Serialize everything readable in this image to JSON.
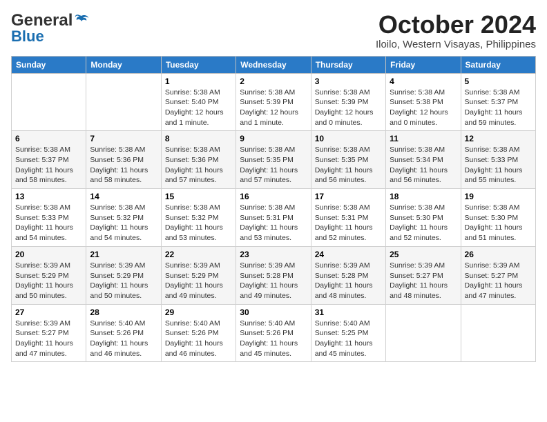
{
  "header": {
    "logo_line1": "General",
    "logo_line2": "Blue",
    "month": "October 2024",
    "location": "Iloilo, Western Visayas, Philippines"
  },
  "weekdays": [
    "Sunday",
    "Monday",
    "Tuesday",
    "Wednesday",
    "Thursday",
    "Friday",
    "Saturday"
  ],
  "weeks": [
    [
      {
        "day": "",
        "sunrise": "",
        "sunset": "",
        "daylight": ""
      },
      {
        "day": "",
        "sunrise": "",
        "sunset": "",
        "daylight": ""
      },
      {
        "day": "1",
        "sunrise": "Sunrise: 5:38 AM",
        "sunset": "Sunset: 5:40 PM",
        "daylight": "Daylight: 12 hours and 1 minute."
      },
      {
        "day": "2",
        "sunrise": "Sunrise: 5:38 AM",
        "sunset": "Sunset: 5:39 PM",
        "daylight": "Daylight: 12 hours and 1 minute."
      },
      {
        "day": "3",
        "sunrise": "Sunrise: 5:38 AM",
        "sunset": "Sunset: 5:39 PM",
        "daylight": "Daylight: 12 hours and 0 minutes."
      },
      {
        "day": "4",
        "sunrise": "Sunrise: 5:38 AM",
        "sunset": "Sunset: 5:38 PM",
        "daylight": "Daylight: 12 hours and 0 minutes."
      },
      {
        "day": "5",
        "sunrise": "Sunrise: 5:38 AM",
        "sunset": "Sunset: 5:37 PM",
        "daylight": "Daylight: 11 hours and 59 minutes."
      }
    ],
    [
      {
        "day": "6",
        "sunrise": "Sunrise: 5:38 AM",
        "sunset": "Sunset: 5:37 PM",
        "daylight": "Daylight: 11 hours and 58 minutes."
      },
      {
        "day": "7",
        "sunrise": "Sunrise: 5:38 AM",
        "sunset": "Sunset: 5:36 PM",
        "daylight": "Daylight: 11 hours and 58 minutes."
      },
      {
        "day": "8",
        "sunrise": "Sunrise: 5:38 AM",
        "sunset": "Sunset: 5:36 PM",
        "daylight": "Daylight: 11 hours and 57 minutes."
      },
      {
        "day": "9",
        "sunrise": "Sunrise: 5:38 AM",
        "sunset": "Sunset: 5:35 PM",
        "daylight": "Daylight: 11 hours and 57 minutes."
      },
      {
        "day": "10",
        "sunrise": "Sunrise: 5:38 AM",
        "sunset": "Sunset: 5:35 PM",
        "daylight": "Daylight: 11 hours and 56 minutes."
      },
      {
        "day": "11",
        "sunrise": "Sunrise: 5:38 AM",
        "sunset": "Sunset: 5:34 PM",
        "daylight": "Daylight: 11 hours and 56 minutes."
      },
      {
        "day": "12",
        "sunrise": "Sunrise: 5:38 AM",
        "sunset": "Sunset: 5:33 PM",
        "daylight": "Daylight: 11 hours and 55 minutes."
      }
    ],
    [
      {
        "day": "13",
        "sunrise": "Sunrise: 5:38 AM",
        "sunset": "Sunset: 5:33 PM",
        "daylight": "Daylight: 11 hours and 54 minutes."
      },
      {
        "day": "14",
        "sunrise": "Sunrise: 5:38 AM",
        "sunset": "Sunset: 5:32 PM",
        "daylight": "Daylight: 11 hours and 54 minutes."
      },
      {
        "day": "15",
        "sunrise": "Sunrise: 5:38 AM",
        "sunset": "Sunset: 5:32 PM",
        "daylight": "Daylight: 11 hours and 53 minutes."
      },
      {
        "day": "16",
        "sunrise": "Sunrise: 5:38 AM",
        "sunset": "Sunset: 5:31 PM",
        "daylight": "Daylight: 11 hours and 53 minutes."
      },
      {
        "day": "17",
        "sunrise": "Sunrise: 5:38 AM",
        "sunset": "Sunset: 5:31 PM",
        "daylight": "Daylight: 11 hours and 52 minutes."
      },
      {
        "day": "18",
        "sunrise": "Sunrise: 5:38 AM",
        "sunset": "Sunset: 5:30 PM",
        "daylight": "Daylight: 11 hours and 52 minutes."
      },
      {
        "day": "19",
        "sunrise": "Sunrise: 5:38 AM",
        "sunset": "Sunset: 5:30 PM",
        "daylight": "Daylight: 11 hours and 51 minutes."
      }
    ],
    [
      {
        "day": "20",
        "sunrise": "Sunrise: 5:39 AM",
        "sunset": "Sunset: 5:29 PM",
        "daylight": "Daylight: 11 hours and 50 minutes."
      },
      {
        "day": "21",
        "sunrise": "Sunrise: 5:39 AM",
        "sunset": "Sunset: 5:29 PM",
        "daylight": "Daylight: 11 hours and 50 minutes."
      },
      {
        "day": "22",
        "sunrise": "Sunrise: 5:39 AM",
        "sunset": "Sunset: 5:29 PM",
        "daylight": "Daylight: 11 hours and 49 minutes."
      },
      {
        "day": "23",
        "sunrise": "Sunrise: 5:39 AM",
        "sunset": "Sunset: 5:28 PM",
        "daylight": "Daylight: 11 hours and 49 minutes."
      },
      {
        "day": "24",
        "sunrise": "Sunrise: 5:39 AM",
        "sunset": "Sunset: 5:28 PM",
        "daylight": "Daylight: 11 hours and 48 minutes."
      },
      {
        "day": "25",
        "sunrise": "Sunrise: 5:39 AM",
        "sunset": "Sunset: 5:27 PM",
        "daylight": "Daylight: 11 hours and 48 minutes."
      },
      {
        "day": "26",
        "sunrise": "Sunrise: 5:39 AM",
        "sunset": "Sunset: 5:27 PM",
        "daylight": "Daylight: 11 hours and 47 minutes."
      }
    ],
    [
      {
        "day": "27",
        "sunrise": "Sunrise: 5:39 AM",
        "sunset": "Sunset: 5:27 PM",
        "daylight": "Daylight: 11 hours and 47 minutes."
      },
      {
        "day": "28",
        "sunrise": "Sunrise: 5:40 AM",
        "sunset": "Sunset: 5:26 PM",
        "daylight": "Daylight: 11 hours and 46 minutes."
      },
      {
        "day": "29",
        "sunrise": "Sunrise: 5:40 AM",
        "sunset": "Sunset: 5:26 PM",
        "daylight": "Daylight: 11 hours and 46 minutes."
      },
      {
        "day": "30",
        "sunrise": "Sunrise: 5:40 AM",
        "sunset": "Sunset: 5:26 PM",
        "daylight": "Daylight: 11 hours and 45 minutes."
      },
      {
        "day": "31",
        "sunrise": "Sunrise: 5:40 AM",
        "sunset": "Sunset: 5:25 PM",
        "daylight": "Daylight: 11 hours and 45 minutes."
      },
      {
        "day": "",
        "sunrise": "",
        "sunset": "",
        "daylight": ""
      },
      {
        "day": "",
        "sunrise": "",
        "sunset": "",
        "daylight": ""
      }
    ]
  ]
}
